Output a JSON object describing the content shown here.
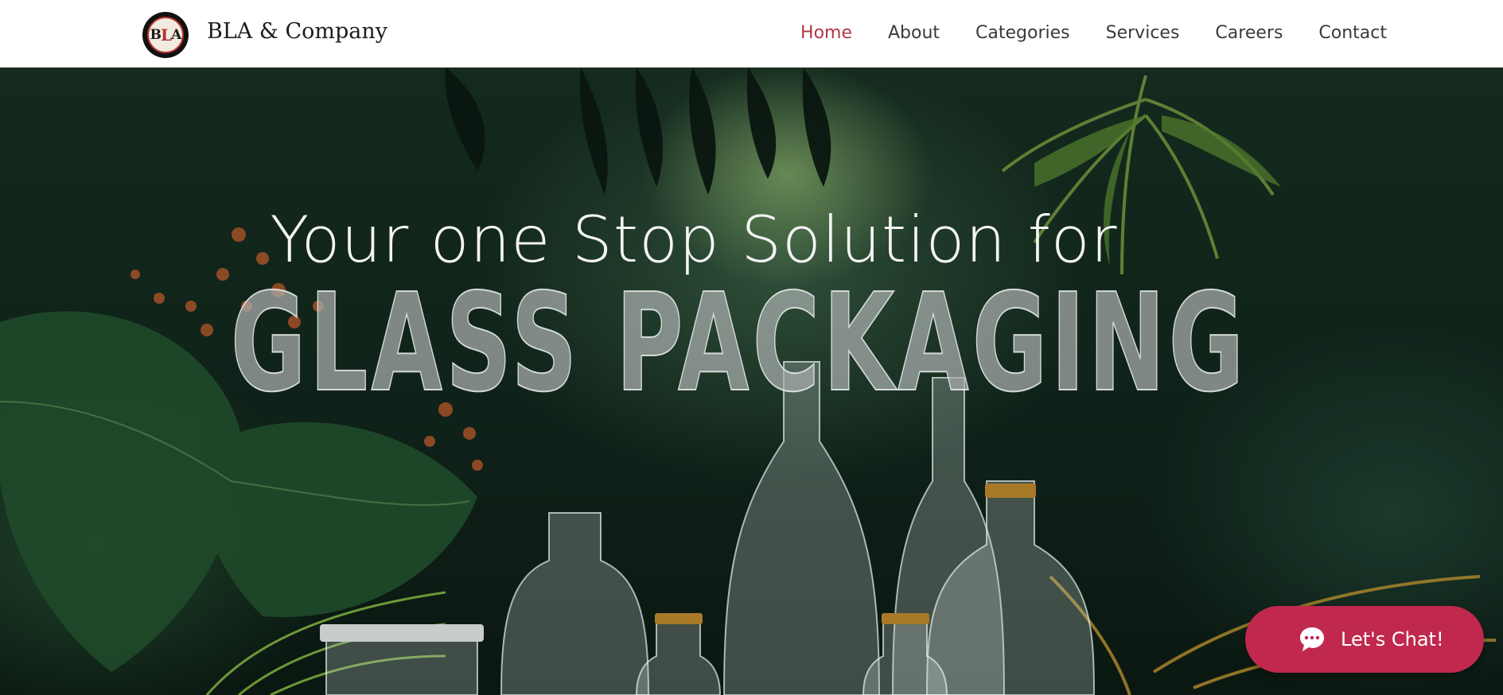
{
  "header": {
    "brand": "BLA & Company",
    "logo_text": "BLA",
    "nav": [
      {
        "label": "Home",
        "active": true
      },
      {
        "label": "About",
        "active": false
      },
      {
        "label": "Categories",
        "active": false
      },
      {
        "label": "Services",
        "active": false
      },
      {
        "label": "Careers",
        "active": false
      },
      {
        "label": "Contact",
        "active": false
      }
    ]
  },
  "hero": {
    "tagline": "Your one Stop Solution for",
    "headline": "GLASS PACKAGING"
  },
  "chat": {
    "label": "Let's Chat!",
    "icon": "chat-bubble-icon"
  },
  "colors": {
    "nav_active": "#b23643",
    "chat_button": "#c0294d",
    "header_bg": "#ffffff"
  }
}
